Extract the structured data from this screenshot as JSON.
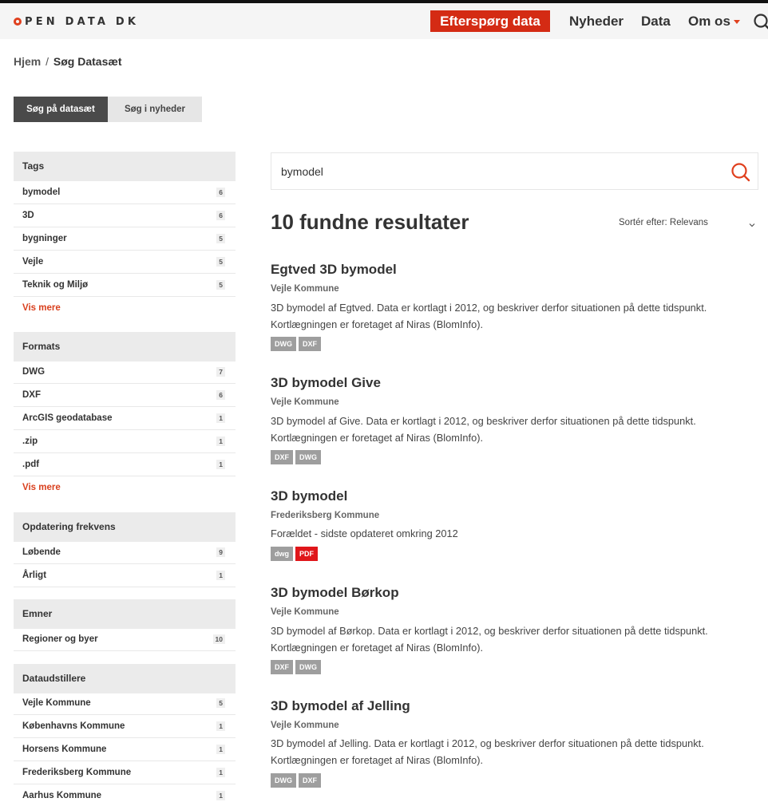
{
  "header": {
    "logo_text": "PEN DATA DK",
    "cta": "Efterspørg data",
    "nav": {
      "news": "Nyheder",
      "data": "Data",
      "about": "Om os"
    }
  },
  "breadcrumb": {
    "home": "Hjem",
    "sep": "/",
    "current": "Søg Datasæt"
  },
  "tabs": {
    "datasets": "Søg på datasæt",
    "news": "Søg i nyheder"
  },
  "facets": {
    "tags": {
      "title": "Tags",
      "items": [
        {
          "label": "bymodel",
          "count": "6"
        },
        {
          "label": "3D",
          "count": "6"
        },
        {
          "label": "bygninger",
          "count": "5"
        },
        {
          "label": "Vejle",
          "count": "5"
        },
        {
          "label": "Teknik og Miljø",
          "count": "5"
        }
      ],
      "more": "Vis mere"
    },
    "formats": {
      "title": "Formats",
      "items": [
        {
          "label": "DWG",
          "count": "7"
        },
        {
          "label": "DXF",
          "count": "6"
        },
        {
          "label": "ArcGIS geodatabase",
          "count": "1"
        },
        {
          "label": ".zip",
          "count": "1"
        },
        {
          "label": ".pdf",
          "count": "1"
        }
      ],
      "more": "Vis mere"
    },
    "frequency": {
      "title": "Opdatering frekvens",
      "items": [
        {
          "label": "Løbende",
          "count": "9"
        },
        {
          "label": "Årligt",
          "count": "1"
        }
      ]
    },
    "subjects": {
      "title": "Emner",
      "items": [
        {
          "label": "Regioner og byer",
          "count": "10"
        }
      ]
    },
    "publishers": {
      "title": "Dataudstillere",
      "items": [
        {
          "label": "Vejle Kommune",
          "count": "5"
        },
        {
          "label": "Københavns Kommune",
          "count": "1"
        },
        {
          "label": "Horsens Kommune",
          "count": "1"
        },
        {
          "label": "Frederiksberg Kommune",
          "count": "1"
        },
        {
          "label": "Aarhus Kommune",
          "count": "1"
        }
      ]
    }
  },
  "search": {
    "value": "bymodel"
  },
  "results_count": "10 fundne resultater",
  "sort": "Sortér efter: Relevans",
  "results": [
    {
      "title": "Egtved 3D bymodel",
      "org": "Vejle Kommune",
      "desc": "3D bymodel af Egtved. Data er kortlagt i 2012, og beskriver derfor situationen på dette tidspunkt. Kortlægningen er foretaget af Niras (BlomInfo).",
      "badges": [
        "DWG",
        "DXF"
      ]
    },
    {
      "title": "3D bymodel Give",
      "org": "Vejle Kommune",
      "desc": "3D bymodel af Give. Data er kortlagt i 2012, og beskriver derfor situationen på dette tidspunkt. Kortlægningen er foretaget af Niras (BlomInfo).",
      "badges": [
        "DXF",
        "DWG"
      ]
    },
    {
      "title": "3D bymodel",
      "org": "Frederiksberg Kommune",
      "desc": "Forældet - sidste opdateret omkring 2012",
      "badges": [
        "dwg",
        "PDF"
      ]
    },
    {
      "title": "3D bymodel Børkop",
      "org": "Vejle Kommune",
      "desc": "3D bymodel af Børkop. Data er kortlagt i 2012, og beskriver derfor situationen på dette tidspunkt. Kortlægningen er foretaget af Niras (BlomInfo).",
      "badges": [
        "DXF",
        "DWG"
      ]
    },
    {
      "title": "3D bymodel af Jelling",
      "org": "Vejle Kommune",
      "desc": "3D bymodel af Jelling. Data er kortlagt i 2012, og beskriver derfor situationen på dette tidspunkt. Kortlægningen er foretaget af Niras (BlomInfo).",
      "badges": [
        "DWG",
        "DXF"
      ]
    }
  ],
  "colors": {
    "accent": "#d42b14",
    "pdf_badge": "#e0161a",
    "badge": "#9e9e9e"
  },
  "icons": {
    "search": "search-icon",
    "caret": "chevron-down-icon"
  }
}
